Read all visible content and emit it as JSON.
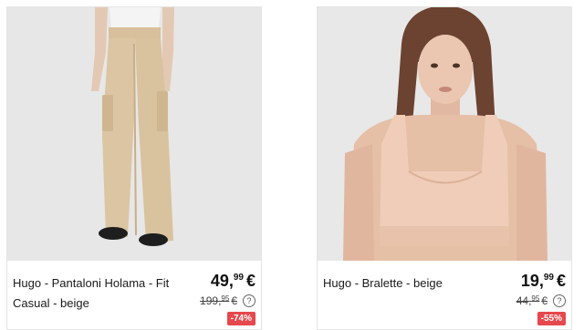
{
  "products": [
    {
      "name": "Hugo - Pantaloni Holama - Fit Casual - beige",
      "price_int": "49",
      "price_dec": "99",
      "currency": "€",
      "old_price_int": "199",
      "old_price_dec": "95",
      "discount": "-74%",
      "help": "?"
    },
    {
      "name": "Hugo - Bralette - beige",
      "price_int": "19",
      "price_dec": "99",
      "currency": "€",
      "old_price_int": "44",
      "old_price_dec": "95",
      "discount": "-55%",
      "help": "?"
    }
  ],
  "colors": {
    "discount_badge": "#e5484d",
    "image_background": "#e6e6e6",
    "card_border": "#e4e4e4"
  }
}
